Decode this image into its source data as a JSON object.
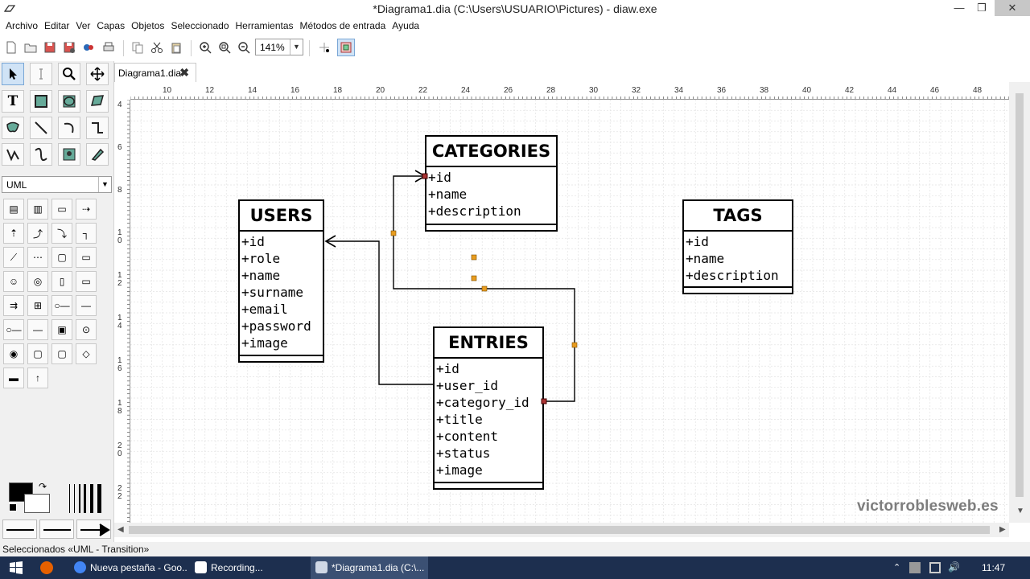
{
  "window": {
    "title": "*Diagrama1.dia (C:\\Users\\USUARIO\\Pictures) - diaw.exe",
    "minimize": "—",
    "restore": "❐",
    "close": "✕"
  },
  "menu": [
    "Archivo",
    "Editar",
    "Ver",
    "Capas",
    "Objetos",
    "Seleccionado",
    "Herramientas",
    "Métodos de entrada",
    "Ayuda"
  ],
  "toolbar": {
    "zoom": "141%",
    "icons": [
      "new-file-icon",
      "open-folder-icon",
      "save-icon",
      "save-as-icon",
      "export-icon",
      "print-icon",
      "copy-icon",
      "cut-icon",
      "paste-icon",
      "zoom-in-icon",
      "zoom-best-fit-icon",
      "zoom-out-icon",
      "snap-to-grid-icon",
      "snap-to-objects-icon"
    ]
  },
  "toolbox": {
    "sheet": "UML",
    "tools": [
      "pointer-icon",
      "text-edit-icon",
      "magnify-icon",
      "scroll-icon",
      "text-icon",
      "box-icon",
      "ellipse-icon",
      "polygon-icon",
      "beziergon-icon",
      "line-icon",
      "arc-icon",
      "zigzag-line-icon",
      "polyline-icon",
      "bezier-line-icon",
      "image-icon",
      "outline-icon"
    ]
  },
  "tab": {
    "label": "Diagrama1.dia",
    "close": "✖"
  },
  "ruler": {
    "h_labels": [
      "10",
      "12",
      "14",
      "16",
      "18",
      "20",
      "22",
      "24",
      "26",
      "28",
      "30",
      "32",
      "34",
      "36",
      "38",
      "40",
      "42",
      "44",
      "46",
      "48"
    ],
    "v_labels": [
      "4",
      "6",
      "8",
      "1 0",
      "1 2",
      "1 4",
      "1 6",
      "1 8",
      "2 0",
      "2 2"
    ]
  },
  "diagram": {
    "categories": {
      "name": "CATEGORIES",
      "attrs": [
        "+id",
        "+name",
        "+description"
      ]
    },
    "users": {
      "name": "USERS",
      "attrs": [
        "+id",
        "+role",
        "+name",
        "+surname",
        "+email",
        "+password",
        "+image"
      ]
    },
    "tags": {
      "name": "TAGS",
      "attrs": [
        "+id",
        "+name",
        "+description"
      ]
    },
    "entries": {
      "name": "ENTRIES",
      "attrs": [
        "+id",
        "+user_id",
        "+category_id",
        "+title",
        "+content",
        "+status",
        "+image"
      ]
    }
  },
  "line_styles": {
    "colors": {
      "foreground": "#000000",
      "background": "#ffffff"
    }
  },
  "status": "Seleccionados «UML - Transition»",
  "watermark": "victorroblesweb.es",
  "taskbar": {
    "tasks": [
      "Nueva pestaña - Goo...",
      "Recording...",
      "*Diagrama1.dia (C:\\..."
    ],
    "clock": "11:47"
  }
}
